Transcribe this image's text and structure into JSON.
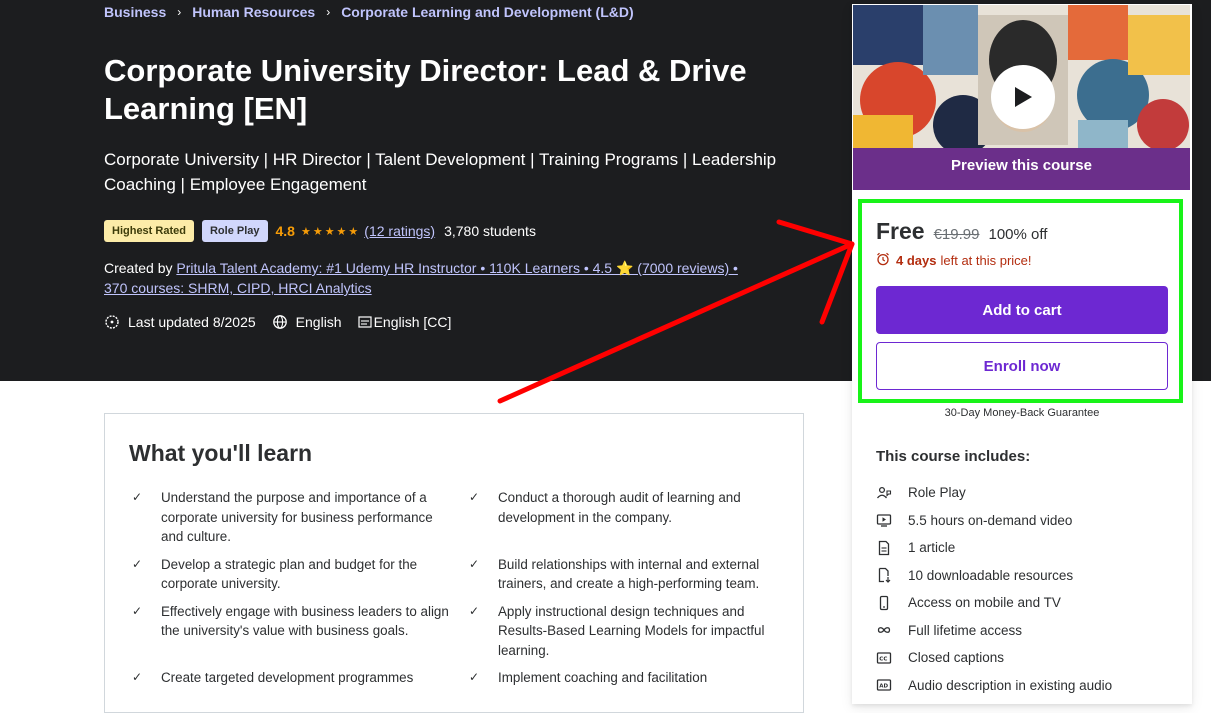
{
  "breadcrumb": [
    "Business",
    "Human Resources",
    "Corporate Learning and Development (L&D)"
  ],
  "course": {
    "title": "Corporate University Director: Lead & Drive Learning [EN]",
    "subtitle": "Corporate University | HR Director | Talent Development | Training Programs | Leadership Coaching | Employee Engagement",
    "badges": [
      "Highest Rated",
      "Role Play"
    ],
    "rating": "4.8",
    "stars": "★★★★★",
    "ratings_count": "(12 ratings)",
    "students": "3,780 students",
    "created_by_label": "Created by",
    "instructor": "Pritula Talent Academy: #1 Udemy HR Instructor • 110K Learners • 4.5 ⭐ (7000 reviews) • 370 courses: SHRM, CIPD, HRCI Analytics",
    "last_updated": "Last updated 8/2025",
    "language": "English",
    "captions": "English [CC]"
  },
  "learn": {
    "heading": "What you'll learn",
    "items": [
      "Understand the purpose and importance of a corporate university for business performance and culture.",
      "Conduct a thorough audit of learning and development in the company.",
      "Develop a strategic plan and budget for the corporate university.",
      "Build relationships with internal and external trainers, and create a high-performing team.",
      "Effectively engage with business leaders to align the university's value with business goals.",
      "Apply instructional design techniques and Results-Based Learning Models for impactful learning.",
      "Create targeted development programmes",
      "Implement coaching and facilitation"
    ]
  },
  "sidebar": {
    "preview_label": "Preview this course",
    "price": "Free",
    "original_price": "€19.99",
    "discount": "100% off",
    "timer_days": "4 days",
    "timer_rest": "left at this price!",
    "add_to_cart": "Add to cart",
    "enroll_now": "Enroll now",
    "guarantee": "30-Day Money-Back Guarantee",
    "includes_title": "This course includes:",
    "includes": [
      {
        "icon": "role-play-icon",
        "label": "Role Play"
      },
      {
        "icon": "video-icon",
        "label": "5.5 hours on-demand video"
      },
      {
        "icon": "article-icon",
        "label": "1 article"
      },
      {
        "icon": "download-icon",
        "label": "10 downloadable resources"
      },
      {
        "icon": "mobile-icon",
        "label": "Access on mobile and TV"
      },
      {
        "icon": "infinity-icon",
        "label": "Full lifetime access"
      },
      {
        "icon": "captions-icon",
        "label": "Closed captions"
      },
      {
        "icon": "audio-description-icon",
        "label": "Audio description in existing audio"
      }
    ]
  },
  "colors": {
    "hero_bg": "#1c1d1f",
    "link": "#c0c4fc",
    "primary": "#6d28d2",
    "highlight_box": "#18f318",
    "annotation_arrow": "#ff0000"
  }
}
